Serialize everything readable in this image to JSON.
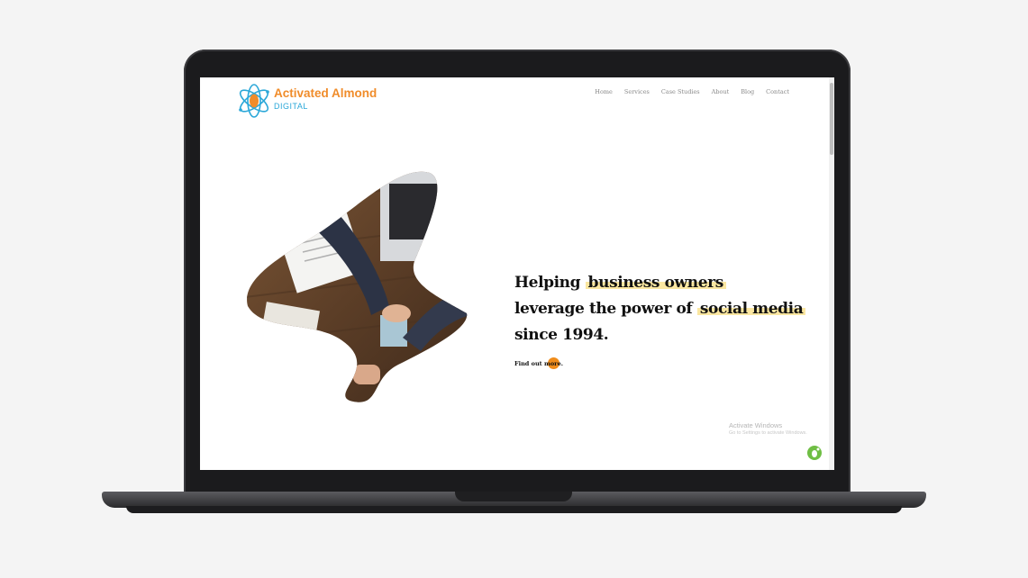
{
  "brand": {
    "name": "Activated Almond",
    "sub": "DIGITAL",
    "orange": "#f08c2a",
    "blue": "#2aa7d8"
  },
  "nav": {
    "items": [
      "Home",
      "Services",
      "Case Studies",
      "About",
      "Blog",
      "Contact"
    ]
  },
  "hero": {
    "line1_pre": "Helping",
    "line1_hl": "business owners",
    "line2_pre": "leverage the power of",
    "line2_hl": "social media",
    "line3": "since 1994.",
    "cta_label": "Find out more.",
    "highlight_color": "#fbe7a1",
    "cta_color": "#f08c1a"
  },
  "windows_notice": {
    "title": "Activate Windows",
    "subtitle": "Go to Settings to activate Windows."
  },
  "icons": {
    "logo": "atom-almond-icon",
    "chat": "chat-badge-icon"
  }
}
